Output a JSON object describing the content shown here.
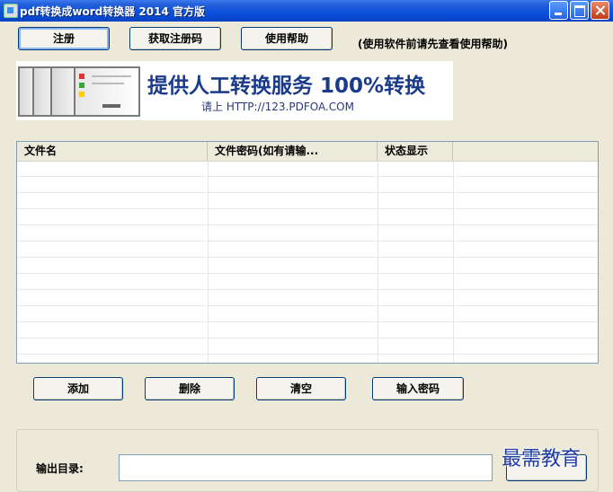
{
  "window": {
    "title": "pdf转换成word转换器 2014 官方版"
  },
  "toolbar": {
    "register_label": "注册",
    "get_code_label": "获取注册码",
    "help_label": "使用帮助",
    "hint": "(使用软件前请先查看使用帮助)"
  },
  "banner": {
    "headline": "提供人工转换服务 100%转换",
    "sub": "请上 HTTP://123.PDFOA.COM"
  },
  "list": {
    "columns": [
      "文件名",
      "文件密码(如有请输...",
      "状态显示",
      ""
    ],
    "rows": []
  },
  "actions": {
    "add_label": "添加",
    "delete_label": "删除",
    "clear_label": "清空",
    "password_label": "输入密码"
  },
  "output": {
    "label": "输出目录:",
    "value": ""
  },
  "watermark": "最需教育",
  "colors": {
    "titlebar": "#0a4fdc",
    "window_bg": "#ece9d8",
    "banner_text": "#1a3a8a",
    "watermark": "#1d3aa0"
  }
}
